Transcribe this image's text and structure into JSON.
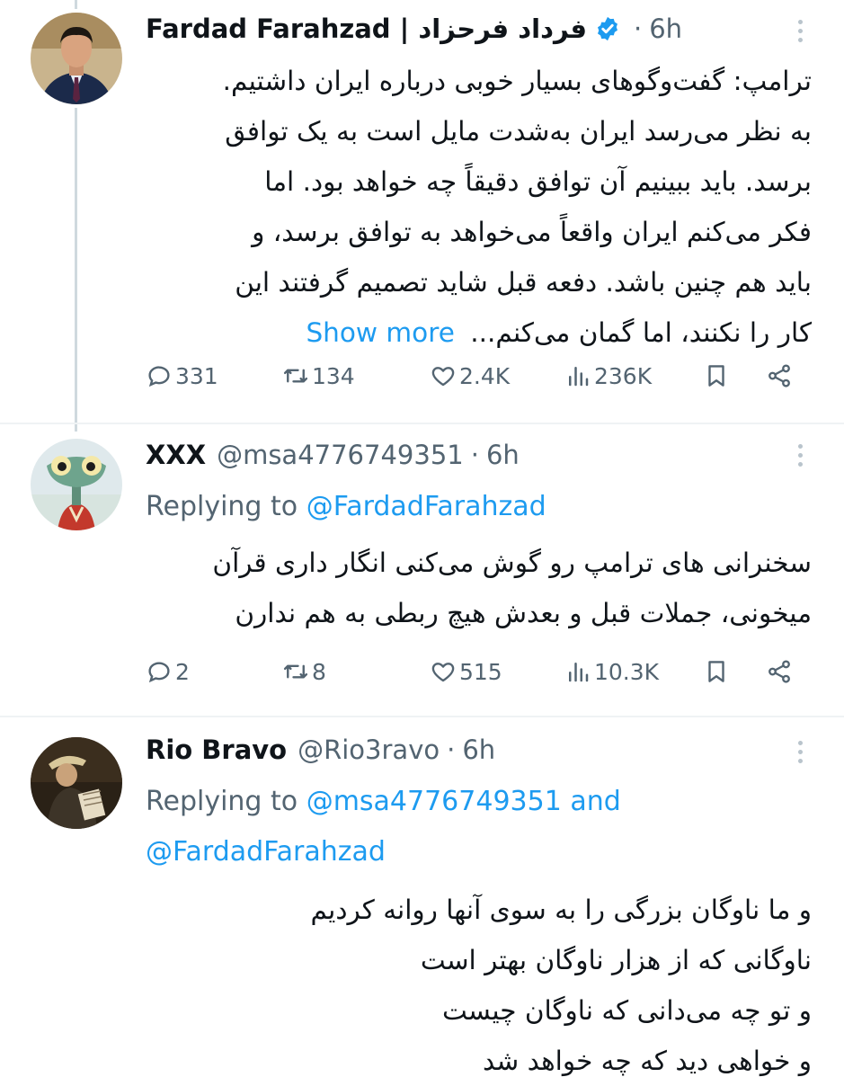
{
  "tweets": [
    {
      "name": "Fardad Farahzad | فرداد فرحزاد",
      "verified": true,
      "time": "6h",
      "lines": [
        "ترامپ: گفت‌وگوهای بسیار خوبی درباره ایران داشتیم.",
        "به نظر می‌رسد ایران به‌شدت مایل است به یک توافق",
        "برسد. باید ببینیم آن توافق دقیقاً چه خواهد بود. اما",
        "فکر می‌کنم ایران واقعاً می‌خواهد به توافق برسد، و",
        "باید هم چنین باشد. دفعه قبل شاید تصمیم گرفتند این",
        "کار را نکنند، اما گمان می‌کنم..."
      ],
      "show_more": "Show more",
      "stats": {
        "replies": "331",
        "reposts": "134",
        "likes": "2.4K",
        "views": "236K"
      }
    },
    {
      "name": "XXX",
      "handle": "@msa4776749351",
      "time": "6h",
      "replying_label": "Replying to",
      "replying_to": "@FardadFarahzad",
      "lines": [
        "سخنرانی های ترامپ رو گوش می‌کنی انگار داری قرآن",
        "میخونی، جملات قبل و بعدش هیچ ربطی به هم ندارن"
      ],
      "stats": {
        "replies": "2",
        "reposts": "8",
        "likes": "515",
        "views": "10.3K"
      }
    },
    {
      "name": "Rio Bravo",
      "handle": "@Rio3ravo",
      "time": "6h",
      "replying_label": "Replying to",
      "replying_to_1": "@msa4776749351",
      "replying_and": "and",
      "replying_to_2": "@FardadFarahzad",
      "lines": [
        "و ما ناوگان بزرگی را به سوی آنها روانه کردیم",
        "ناوگانی که از هزار ناوگان بهتر است",
        "و تو چه می‌دانی که ناوگان چیست",
        "و خواهی دید که چه خواهد شد"
      ]
    }
  ],
  "colors": {
    "accent": "#1d9bf0",
    "muted": "#536471",
    "text": "#0f1419",
    "thread_line": "#cfd9de"
  }
}
